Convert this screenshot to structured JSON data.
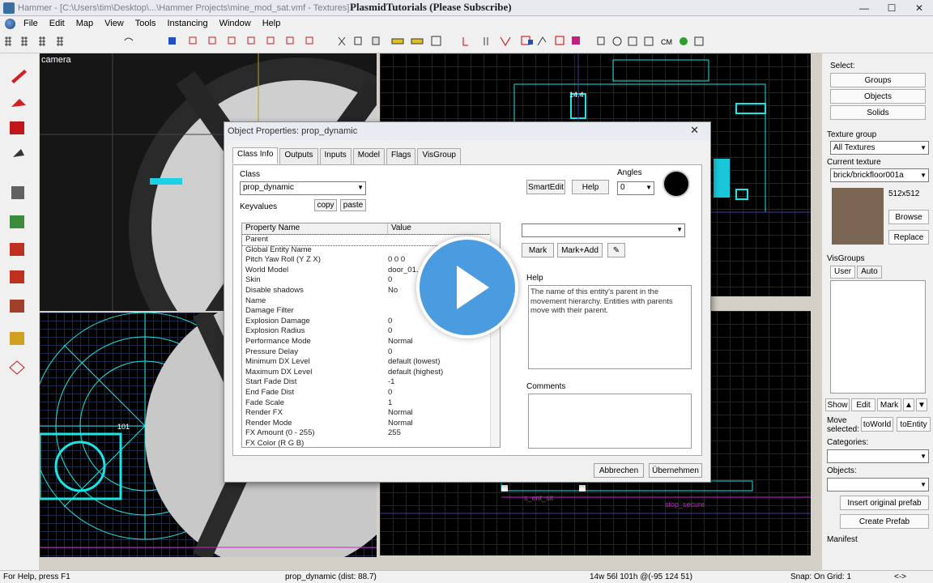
{
  "window": {
    "title": "Hammer - [C:\\Users\\tim\\Desktop\\...\\Hammer Projects\\mine_mod_sat.vmf - Textures]",
    "overlay_title": "PlasmidTutorials (Please Subscribe)",
    "min": "—",
    "max": "☐",
    "close": "✕"
  },
  "menu": [
    "File",
    "Edit",
    "Map",
    "View",
    "Tools",
    "Instancing",
    "Window",
    "Help"
  ],
  "viewports": {
    "camera_label": "camera",
    "top_label1": "14.4",
    "front_label": "101",
    "side_label1": "s_ent_sit",
    "side_label2": "stop_secure"
  },
  "right_panel": {
    "select_label": "Select:",
    "groups": "Groups",
    "objects": "Objects",
    "solids": "Solids",
    "texture_group_label": "Texture group",
    "texture_group_value": "All Textures",
    "current_texture_label": "Current texture",
    "current_texture_value": "brick/brickfloor001a",
    "texture_size": "512x512",
    "browse": "Browse",
    "replace": "Replace",
    "visgroups_label": "VisGroups",
    "user_tab": "User",
    "auto_tab": "Auto",
    "show": "Show",
    "edit": "Edit",
    "mark": "Mark",
    "move_selected": "Move selected:",
    "to_world": "toWorld",
    "to_entity": "toEntity",
    "categories_label": "Categories:",
    "objects_label": "Objects:",
    "insert_prefab": "Insert original prefab",
    "create_prefab": "Create Prefab",
    "manifest_label": "Manifest"
  },
  "dialog": {
    "title": "Object Properties: prop_dynamic",
    "close": "✕",
    "tabs": [
      "Class Info",
      "Outputs",
      "Inputs",
      "Model",
      "Flags",
      "VisGroup"
    ],
    "class_label": "Class",
    "class_value": "prop_dynamic",
    "keyvalues_label": "Keyvalues",
    "copy": "copy",
    "paste": "paste",
    "smartedit": "SmartEdit",
    "help": "Help",
    "angles_label": "Angles",
    "angles_value": "0",
    "col_name": "Property Name",
    "col_value": "Value",
    "properties": [
      {
        "name": "Parent",
        "value": ""
      },
      {
        "name": "Global Entity Name",
        "value": ""
      },
      {
        "name": "Pitch Yaw Roll (Y Z X)",
        "value": "0 0 0"
      },
      {
        "name": "World Model",
        "value": "door_01..."
      },
      {
        "name": "Skin",
        "value": "0"
      },
      {
        "name": "Disable shadows",
        "value": "No"
      },
      {
        "name": "Name",
        "value": ""
      },
      {
        "name": "Damage Filter",
        "value": ""
      },
      {
        "name": "Explosion Damage",
        "value": "0"
      },
      {
        "name": "Explosion Radius",
        "value": "0"
      },
      {
        "name": "Performance Mode",
        "value": "Normal"
      },
      {
        "name": "Pressure Delay",
        "value": "0"
      },
      {
        "name": "Minimum DX Level",
        "value": "default (lowest)"
      },
      {
        "name": "Maximum DX Level",
        "value": "default (highest)"
      },
      {
        "name": "Start Fade Dist",
        "value": "-1"
      },
      {
        "name": "End Fade Dist",
        "value": "0"
      },
      {
        "name": "Fade Scale",
        "value": "1"
      },
      {
        "name": "Render FX",
        "value": "Normal"
      },
      {
        "name": "Render Mode",
        "value": "Normal"
      },
      {
        "name": "FX Amount (0 - 255)",
        "value": "255"
      },
      {
        "name": "FX Color (R G B)",
        "value": ""
      }
    ],
    "mark": "Mark",
    "mark_add": "Mark+Add",
    "help_label": "Help",
    "help_text": "The name of this entity's parent in the movement hierarchy. Entities with parents move with their parent.",
    "comments_label": "Comments",
    "cancel": "Abbrechen",
    "ok": "Übernehmen"
  },
  "status": {
    "help": "For Help, press F1",
    "selection": "prop_dynamic  (dist: 88.7)",
    "size": "14w 56l 101h @(-95 124 51)",
    "snap": "Snap: On Grid: 1",
    "arrows": "<->"
  },
  "colors": {
    "accent_cyan": "#19e6e6",
    "play_blue": "#4a9be0"
  }
}
